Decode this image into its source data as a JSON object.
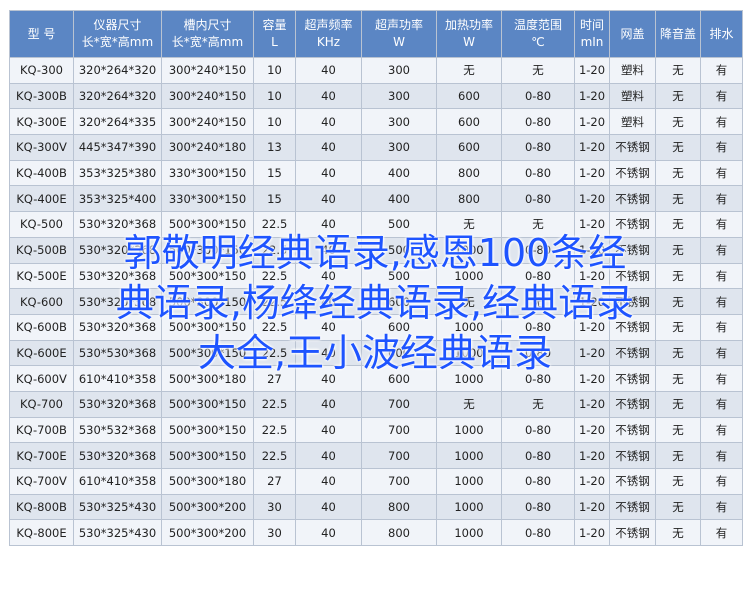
{
  "table": {
    "headers": [
      [
        "型 号",
        ""
      ],
      [
        "仪器尺寸",
        "长*宽*高mm"
      ],
      [
        "槽内尺寸",
        "长*宽*高mm"
      ],
      [
        "容量",
        "L"
      ],
      [
        "超声频率",
        "KHz"
      ],
      [
        "超声功率",
        "W"
      ],
      [
        "加热功率",
        "W"
      ],
      [
        "温度范围",
        "℃"
      ],
      [
        "时间",
        "mIn"
      ],
      [
        "网盖",
        ""
      ],
      [
        "降音盖",
        ""
      ],
      [
        "排水",
        ""
      ]
    ],
    "rows": [
      [
        "KQ-300",
        "320*264*320",
        "300*240*150",
        "10",
        "40",
        "300",
        "无",
        "无",
        "1-20",
        "塑料",
        "无",
        "有"
      ],
      [
        "KQ-300B",
        "320*264*320",
        "300*240*150",
        "10",
        "40",
        "300",
        "600",
        "0-80",
        "1-20",
        "塑料",
        "无",
        "有"
      ],
      [
        "KQ-300E",
        "320*264*335",
        "300*240*150",
        "10",
        "40",
        "300",
        "600",
        "0-80",
        "1-20",
        "塑料",
        "无",
        "有"
      ],
      [
        "KQ-300V",
        "445*347*390",
        "300*240*180",
        "13",
        "40",
        "300",
        "600",
        "0-80",
        "1-20",
        "不锈钢",
        "无",
        "有"
      ],
      [
        "KQ-400B",
        "353*325*380",
        "330*300*150",
        "15",
        "40",
        "400",
        "800",
        "0-80",
        "1-20",
        "不锈钢",
        "无",
        "有"
      ],
      [
        "KQ-400E",
        "353*325*400",
        "330*300*150",
        "15",
        "40",
        "400",
        "800",
        "0-80",
        "1-20",
        "不锈钢",
        "无",
        "有"
      ],
      [
        "KQ-500",
        "530*320*368",
        "500*300*150",
        "22.5",
        "40",
        "500",
        "无",
        "无",
        "1-20",
        "不锈钢",
        "无",
        "有"
      ],
      [
        "KQ-500B",
        "530*320*368",
        "500*300*150",
        "22.5",
        "40",
        "500",
        "1000",
        "0-80",
        "1-20",
        "不锈钢",
        "无",
        "有"
      ],
      [
        "KQ-500E",
        "530*320*368",
        "500*300*150",
        "22.5",
        "40",
        "500",
        "1000",
        "0-80",
        "1-20",
        "不锈钢",
        "无",
        "有"
      ],
      [
        "KQ-600",
        "530*320*368",
        "500*300*150",
        "22.5",
        "40",
        "600",
        "无",
        "无",
        "1-20",
        "不锈钢",
        "无",
        "有"
      ],
      [
        "KQ-600B",
        "530*320*368",
        "500*300*150",
        "22.5",
        "40",
        "600",
        "1000",
        "0-80",
        "1-20",
        "不锈钢",
        "无",
        "有"
      ],
      [
        "KQ-600E",
        "530*530*368",
        "500*300*150",
        "22.5",
        "40",
        "600",
        "1000",
        "0-80",
        "1-20",
        "不锈钢",
        "无",
        "有"
      ],
      [
        "KQ-600V",
        "610*410*358",
        "500*300*180",
        "27",
        "40",
        "600",
        "1000",
        "0-80",
        "1-20",
        "不锈钢",
        "无",
        "有"
      ],
      [
        "KQ-700",
        "530*320*368",
        "500*300*150",
        "22.5",
        "40",
        "700",
        "无",
        "无",
        "1-20",
        "不锈钢",
        "无",
        "有"
      ],
      [
        "KQ-700B",
        "530*532*368",
        "500*300*150",
        "22.5",
        "40",
        "700",
        "1000",
        "0-80",
        "1-20",
        "不锈钢",
        "无",
        "有"
      ],
      [
        "KQ-700E",
        "530*320*368",
        "500*300*150",
        "22.5",
        "40",
        "700",
        "1000",
        "0-80",
        "1-20",
        "不锈钢",
        "无",
        "有"
      ],
      [
        "KQ-700V",
        "610*410*358",
        "500*300*180",
        "27",
        "40",
        "700",
        "1000",
        "0-80",
        "1-20",
        "不锈钢",
        "无",
        "有"
      ],
      [
        "KQ-800B",
        "530*325*430",
        "500*300*200",
        "30",
        "40",
        "800",
        "1000",
        "0-80",
        "1-20",
        "不锈钢",
        "无",
        "有"
      ],
      [
        "KQ-800E",
        "530*325*430",
        "500*300*200",
        "30",
        "40",
        "800",
        "1000",
        "0-80",
        "1-20",
        "不锈钢",
        "无",
        "有"
      ]
    ]
  },
  "overlay": {
    "lines": [
      "郭敬明经典语录,感恩100条经",
      "典语录,杨绛经典语录,经典语录",
      "大全,王小波经典语录"
    ]
  }
}
